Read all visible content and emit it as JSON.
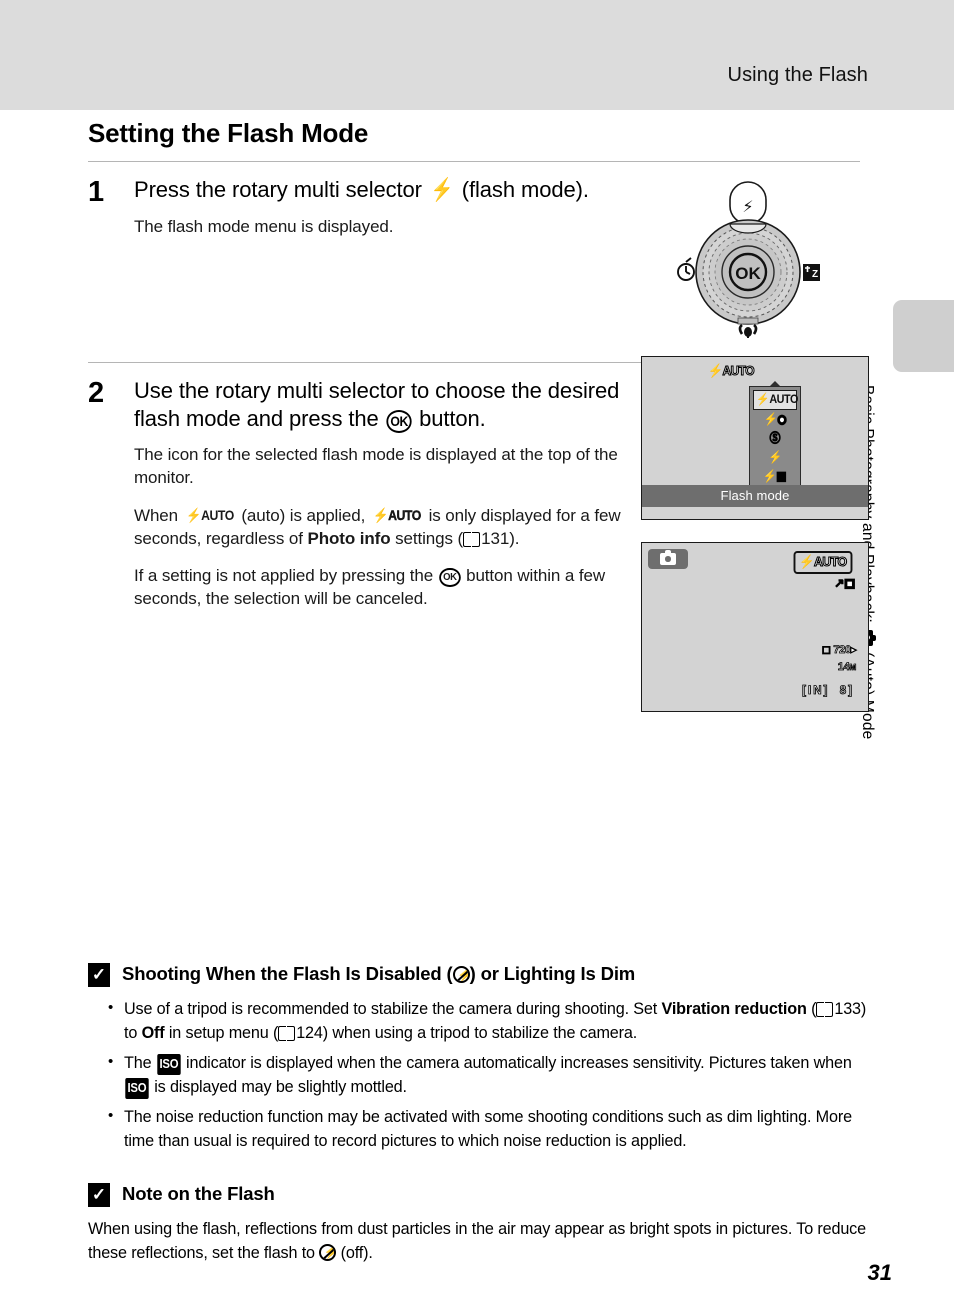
{
  "header": {
    "running_head": "Using the Flash"
  },
  "chapter_tab": {
    "label_before": "Basic Photography and Playback:",
    "icon": "camera-auto-icon",
    "label_after": "(Auto) Mode"
  },
  "section": {
    "title": "Setting the Flash Mode"
  },
  "steps": [
    {
      "number": "1",
      "heading_before": "Press the rotary multi selector",
      "heading_icon": "flash-bolt-icon",
      "heading_after": "(flash mode).",
      "body": [
        "The flash mode menu is displayed."
      ]
    },
    {
      "number": "2",
      "heading_part1": "Use the rotary multi selector to choose the desired flash mode and press the",
      "heading_icon": "ok-button-icon",
      "heading_part2": "button.",
      "para1": "The icon for the selected flash mode is displayed at the top of the monitor.",
      "para2_a": "When",
      "para2_b": "(auto) is applied,",
      "para2_c": "is only displayed for a few seconds, regardless of",
      "para2_bold": "Photo info",
      "para2_d": "settings (",
      "para2_page": "131",
      "para2_e": ").",
      "para3_a": "If a setting is not applied by pressing the",
      "para3_b": "button within a few seconds, the selection will be canceled."
    }
  ],
  "selector_diagram": {
    "name": "rotary-multi-selector",
    "top_icon": "flash-bolt-icon",
    "left_icon": "self-timer-icon",
    "right_icon": "exposure-compensation-icon",
    "bottom_icon": "macro-icon",
    "center_label": "OK"
  },
  "screen_menu": {
    "selected_indicator": "AUTO",
    "pointer": "caret-up-icon",
    "items": [
      {
        "id": "flash-auto",
        "label": "AUTO",
        "selected": true
      },
      {
        "id": "red-eye-reduction",
        "label": "red-eye",
        "selected": false
      },
      {
        "id": "flash-off",
        "label": "off",
        "selected": false
      },
      {
        "id": "fill-flash",
        "label": "fill",
        "selected": false
      },
      {
        "id": "slow-sync",
        "label": "slow",
        "selected": false
      }
    ],
    "label_bar": "Flash mode"
  },
  "screen_shooting": {
    "mode_icon": "camera-auto-icon",
    "flash_badge": "AUTO",
    "sub_indicators": "vibration-reduction-icon",
    "movie_option": "720",
    "image_size": "14",
    "image_size_unit": "M",
    "storage": "IN",
    "shots_remaining": "8"
  },
  "notes": [
    {
      "mark": "warning-mark",
      "heading_a": "Shooting When the Flash Is Disabled (",
      "heading_icon": "flash-off-icon",
      "heading_b": ") or Lighting Is Dim",
      "bullets": [
        {
          "a": "Use of a tripod is recommended to stabilize the camera during shooting. Set",
          "bold1": "Vibration reduction",
          "b": "(",
          "page1": "133",
          "c": ") to",
          "bold2": "Off",
          "d": "in setup menu (",
          "page2": "124",
          "e": ") when using a tripod to stabilize the camera."
        },
        {
          "a": "The",
          "icon1": "ISO",
          "b": "indicator is displayed when the camera automatically increases sensitivity. Pictures taken when",
          "icon2": "ISO",
          "c": "is displayed may be slightly mottled."
        },
        {
          "a": "The noise reduction function may be activated with some shooting conditions such as dim lighting. More time than usual is required to record pictures to which noise reduction is applied."
        }
      ]
    },
    {
      "mark": "warning-mark",
      "heading": "Note on the Flash",
      "para_a": "When using the flash, reflections from dust particles in the air may appear as bright spots in pictures. To reduce these reflections, set the flash to",
      "para_icon": "flash-off-icon",
      "para_b": "(off)."
    }
  ],
  "page": {
    "number": "31"
  },
  "colors": {
    "header_band": "#dcdcdc",
    "tab_gray": "#cfcfcf",
    "screen_bg": "#d3d3d3",
    "screen_bar": "#6e6e6e",
    "menu_bg": "#8a8a8a"
  }
}
